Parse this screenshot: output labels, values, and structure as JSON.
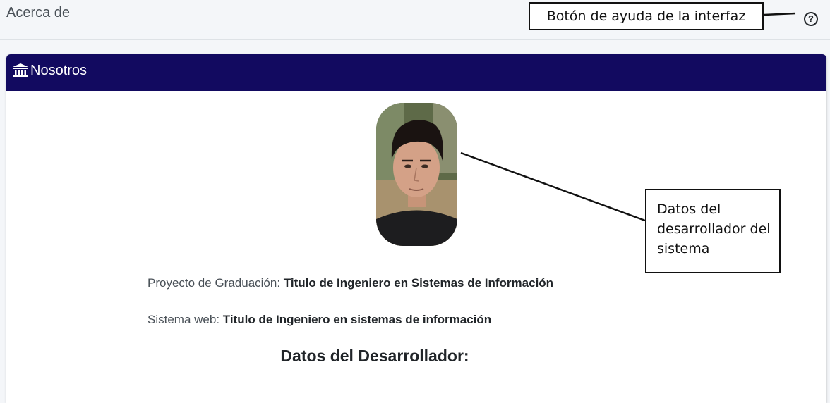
{
  "header": {
    "page_title": "Acerca de",
    "help_icon": "question-circle-icon"
  },
  "card": {
    "title": "Nosotros",
    "icon": "bank-building-icon",
    "header_color": "#120a60"
  },
  "profile": {
    "photo_alt": "Foto del desarrollador",
    "project_label": "Proyecto de Graduación:",
    "project_value": "Titulo de Ingeniero en Sistemas de Información",
    "system_label": "Sistema web:",
    "system_value": "Titulo de Ingeniero en sistemas de información",
    "developer_heading": "Datos del Desarrollador:"
  },
  "annotations": {
    "help_callout": "Botón de ayuda de la interfaz",
    "dev_callout": "Datos del desarrollador del sistema"
  }
}
